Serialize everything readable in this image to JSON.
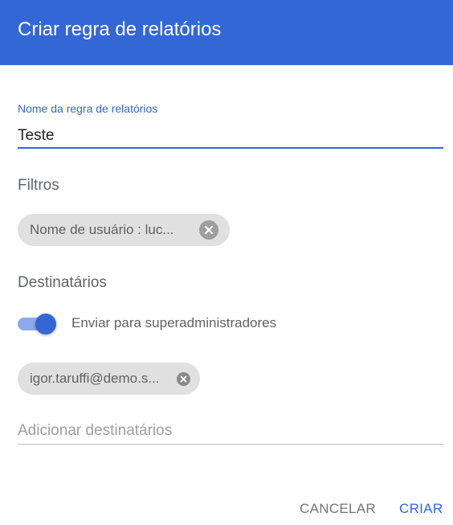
{
  "dialog": {
    "title": "Criar regra de relatórios"
  },
  "name_field": {
    "label": "Nome da regra de relatórios",
    "value": "Teste"
  },
  "filters": {
    "title": "Filtros",
    "chips": [
      {
        "label": "Nome de usuário : luc..."
      }
    ]
  },
  "recipients": {
    "title": "Destinatários",
    "toggle": {
      "label": "Enviar para superadministradores",
      "on": true
    },
    "chips": [
      {
        "label": "igor.taruffi@demo.s..."
      }
    ],
    "input_placeholder": "Adicionar destinatários"
  },
  "actions": {
    "cancel_label": "CANCELAR",
    "create_label": "CRIAR"
  },
  "colors": {
    "accent": "#3367d6",
    "header_bg": "#3367d6",
    "chip_bg": "#e0e0e0",
    "toggle_track": "#8ea9ea"
  },
  "icons": {
    "filter_chip_remove": "close-circle-icon",
    "recipient_chip_remove": "close-circle-icon"
  }
}
